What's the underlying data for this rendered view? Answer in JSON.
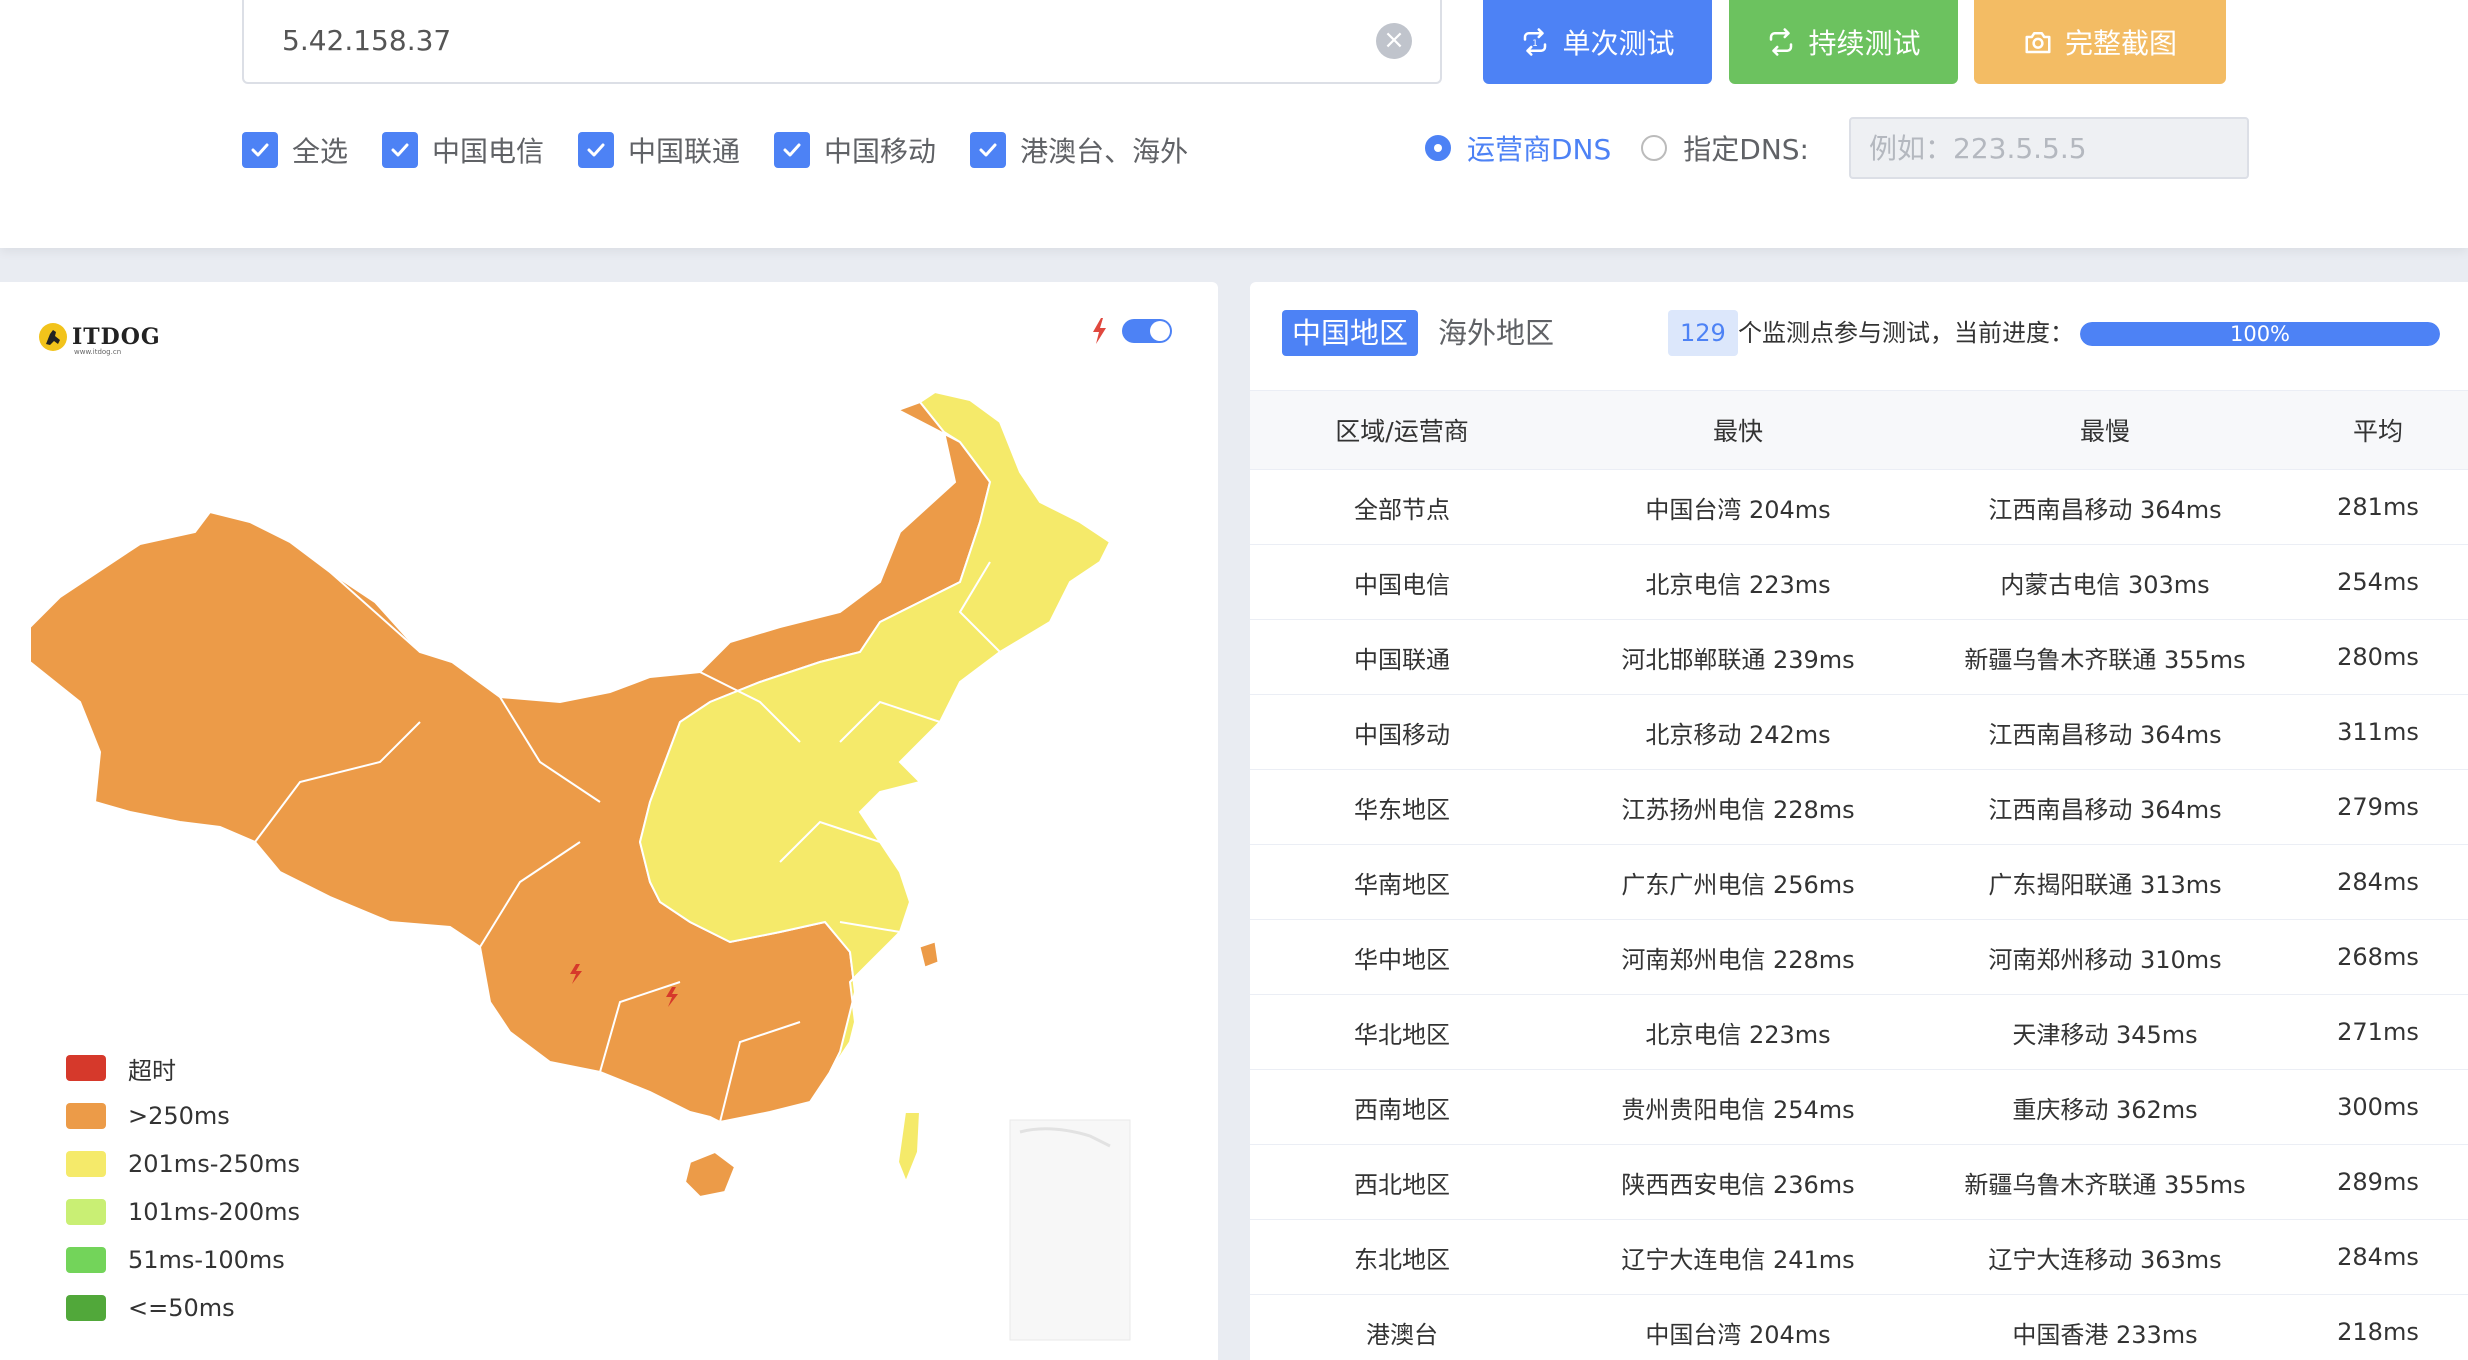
{
  "top": {
    "ip_value": "5.42.158.37",
    "buttons": {
      "single": "单次测试",
      "continuous": "持续测试",
      "screenshot": "完整截图"
    },
    "checkboxes": [
      {
        "label": "全选",
        "checked": true
      },
      {
        "label": "中国电信",
        "checked": true
      },
      {
        "label": "中国联通",
        "checked": true
      },
      {
        "label": "中国移动",
        "checked": true
      },
      {
        "label": "港澳台、海外",
        "checked": true
      }
    ],
    "dns": {
      "option_carrier": "运营商DNS",
      "option_custom": "指定DNS:",
      "selected": "运营商DNS",
      "placeholder": "例如：223.5.5.5"
    }
  },
  "map": {
    "logo": "ITDOG",
    "logo_sub": "www.itdog.cn",
    "toggle_on": true,
    "legend": [
      {
        "label": "超时",
        "color": "#d6392b"
      },
      {
        "label": ">250ms",
        "color": "#ec9b48"
      },
      {
        "label": "201ms-250ms",
        "color": "#f5ea6a"
      },
      {
        "label": "101ms-200ms",
        "color": "#c9ef74"
      },
      {
        "label": "51ms-100ms",
        "color": "#73d45a"
      },
      {
        "label": "<=50ms",
        "color": "#51a83a"
      }
    ]
  },
  "results": {
    "tab_active": "中国地区",
    "tab_inactive": "海外地区",
    "monitor_count": "129",
    "monitor_text": "个监测点参与测试，当前进度：",
    "progress_value": 100,
    "progress_label": "100%",
    "headers": [
      "区域/运营商",
      "最快",
      "最慢",
      "平均"
    ],
    "rows": [
      [
        "全部节点",
        "中国台湾 204ms",
        "江西南昌移动 364ms",
        "281ms"
      ],
      [
        "中国电信",
        "北京电信 223ms",
        "内蒙古电信 303ms",
        "254ms"
      ],
      [
        "中国联通",
        "河北邯郸联通 239ms",
        "新疆乌鲁木齐联通 355ms",
        "280ms"
      ],
      [
        "中国移动",
        "北京移动 242ms",
        "江西南昌移动 364ms",
        "311ms"
      ],
      [
        "华东地区",
        "江苏扬州电信 228ms",
        "江西南昌移动 364ms",
        "279ms"
      ],
      [
        "华南地区",
        "广东广州电信 256ms",
        "广东揭阳联通 313ms",
        "284ms"
      ],
      [
        "华中地区",
        "河南郑州电信 228ms",
        "河南郑州移动 310ms",
        "268ms"
      ],
      [
        "华北地区",
        "北京电信 223ms",
        "天津移动 345ms",
        "271ms"
      ],
      [
        "西南地区",
        "贵州贵阳电信 254ms",
        "重庆移动 362ms",
        "300ms"
      ],
      [
        "西北地区",
        "陕西西安电信 236ms",
        "新疆乌鲁木齐联通 355ms",
        "289ms"
      ],
      [
        "东北地区",
        "辽宁大连电信 241ms",
        "辽宁大连移动 363ms",
        "284ms"
      ],
      [
        "港澳台",
        "中国台湾 204ms",
        "中国香港 233ms",
        "218ms"
      ]
    ]
  }
}
